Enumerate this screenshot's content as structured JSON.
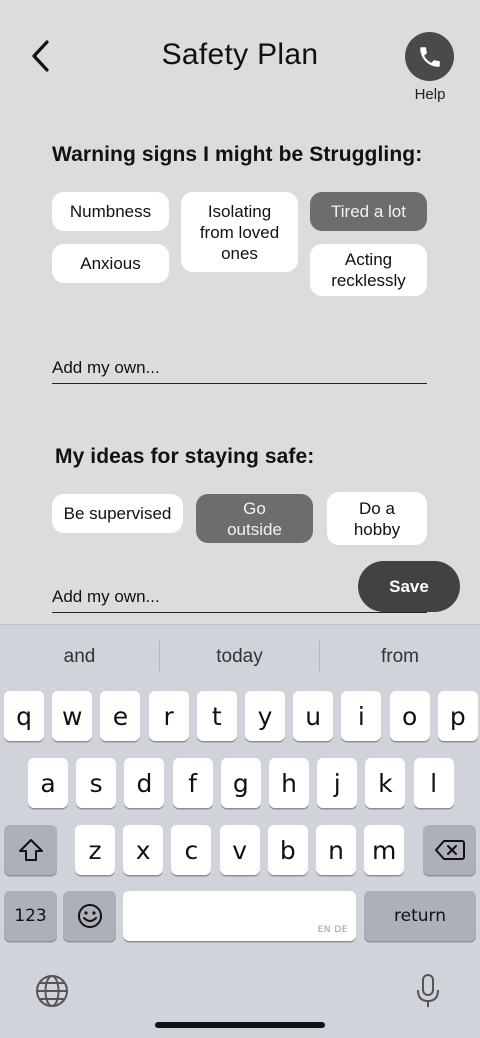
{
  "header": {
    "title": "Safety Plan",
    "help_label": "Help"
  },
  "warning": {
    "heading": "Warning signs I might be Struggling:",
    "chips": [
      {
        "label": "Numbness",
        "selected": false
      },
      {
        "label": "Anxious",
        "selected": false
      },
      {
        "label": "Isolating from loved ones",
        "selected": false
      },
      {
        "label": "Tired a lot",
        "selected": true
      },
      {
        "label": "Acting recklessly",
        "selected": false
      }
    ],
    "add_placeholder": "Add my own..."
  },
  "ideas": {
    "heading": "My ideas for staying safe:",
    "chips": [
      {
        "label": "Be supervised",
        "selected": false
      },
      {
        "label": "Go outside",
        "selected": true
      },
      {
        "label": "Do a hobby",
        "selected": false
      }
    ],
    "add_placeholder": "Add my own..."
  },
  "save_label": "Save",
  "keyboard": {
    "suggestions": [
      "and",
      "today",
      "from"
    ],
    "row1": [
      "q",
      "w",
      "e",
      "r",
      "t",
      "y",
      "u",
      "i",
      "o",
      "p"
    ],
    "row2": [
      "a",
      "s",
      "d",
      "f",
      "g",
      "h",
      "j",
      "k",
      "l"
    ],
    "row3": [
      "z",
      "x",
      "c",
      "v",
      "b",
      "n",
      "m"
    ],
    "numbers_label": "123",
    "return_label": "return",
    "space_lang": "EN DE",
    "icons": [
      "shift-icon",
      "delete-icon",
      "emoji-icon",
      "globe-icon",
      "microphone-icon"
    ]
  },
  "colors": {
    "background": "#dcdcdc",
    "chip": "#ffffff",
    "chip_selected": "#6d6d6d",
    "button_dark": "#424242",
    "keyboard_bg": "#d1d3da"
  }
}
